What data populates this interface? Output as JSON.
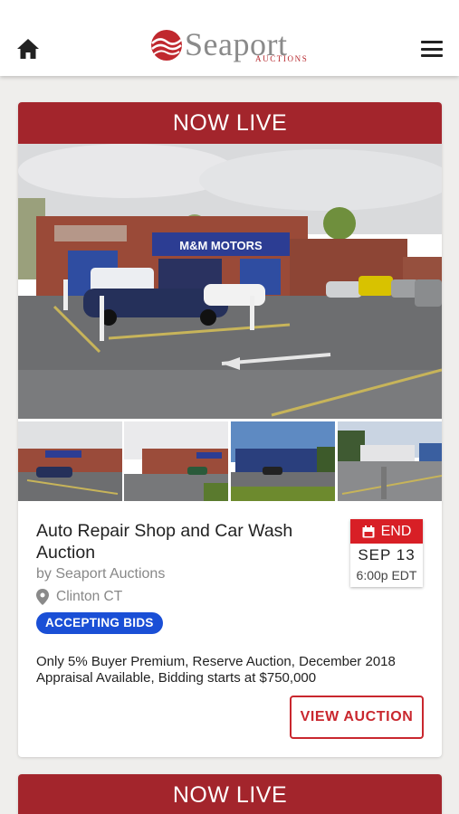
{
  "header": {
    "home_icon": "home-icon",
    "menu_icon": "hamburger-menu-icon",
    "logo": {
      "word": "Seaport",
      "sub": "AUCTIONS",
      "brand_color": "#b7282e"
    }
  },
  "listings": [
    {
      "banner": "NOW LIVE",
      "sign_text": "M&M MOTORS",
      "title": "Auto Repair Shop and Car Wash Auction",
      "seller": "by Seaport Auctions",
      "location": "Clinton CT",
      "status": "ACCEPTING BIDS",
      "date": {
        "label": "END",
        "day": "SEP 13",
        "time": "6:00p EDT"
      },
      "description": "Only 5% Buyer Premium, Reserve Auction, December 2018 Appraisal Available, Bidding starts at $750,000",
      "cta": "VIEW AUCTION"
    },
    {
      "banner": "NOW LIVE"
    }
  ],
  "colors": {
    "banner": "#a3252c",
    "end_badge": "#d81f26",
    "status_badge": "#1a4fd6",
    "cta": "#c9272e"
  }
}
